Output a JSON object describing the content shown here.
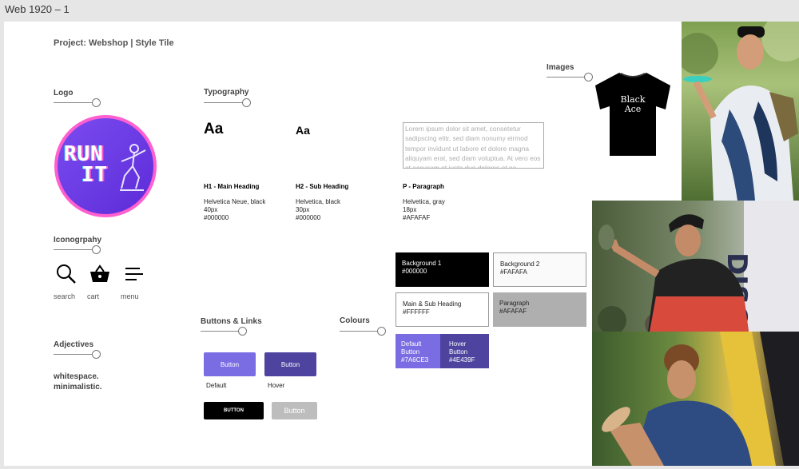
{
  "frame": {
    "title": "Web 1920 – 1"
  },
  "header": {
    "project_title": "Project: Webshop | Style Tile"
  },
  "logo": {
    "section_title": "Logo",
    "line1": "RUN",
    "line2": "IT"
  },
  "iconography": {
    "section_title": "Iconogrpahy",
    "items": [
      {
        "icon": "search-icon",
        "label": "search"
      },
      {
        "icon": "cart-icon",
        "label": "cart"
      },
      {
        "icon": "menu-icon",
        "label": "menu"
      }
    ]
  },
  "adjectives": {
    "section_title": "Adjectives",
    "line1": "whitespace.",
    "line2": "minimalistic."
  },
  "typography": {
    "section_title": "Typography",
    "samples": [
      {
        "sample": "Aa",
        "name": "H1 - Main Heading",
        "font": "Helvetica Neue, black",
        "size": "40px",
        "color": "#000000"
      },
      {
        "sample": "Aa",
        "name": "H2 - Sub Heading",
        "font": "Helvetica, black",
        "size": "30px",
        "color": "#000000"
      },
      {
        "sample": "Lorem ipsum dolor sit amet, consetetur sadipscing elitr, sed diam nonumy eirmod tempor invidunt ut labore et dolore magna aliquyam erat, sed diam voluptua. At vero eos et accusam et justo duo dolores et ea",
        "name": "P - Paragraph",
        "font": "Helvetica, gray",
        "size": "18px",
        "color": "#AFAFAF"
      }
    ]
  },
  "buttons": {
    "section_title": "Buttons & Links",
    "default_label": "Button",
    "hover_label": "Button",
    "caption_default": "Default",
    "caption_hover": "Hover",
    "black_label": "BUTTON",
    "gray_label": "Button"
  },
  "colours": {
    "section_title": "Colours",
    "swatches": [
      {
        "label": "Background 1",
        "hex": "#000000"
      },
      {
        "label": "Background 2",
        "hex": "#FAFAFA"
      },
      {
        "label": "Main & Sub Heading",
        "hex": "#FFFFFF"
      },
      {
        "label": "Paragraph",
        "hex": "#AFAFAF"
      },
      {
        "label": "Default Button",
        "hex": "#7A6CE3"
      },
      {
        "label": "Hover Button",
        "hex": "#4E439F"
      }
    ]
  },
  "images": {
    "section_title": "Images",
    "shirt_text_line1": "Black",
    "shirt_text_line2": "Ace"
  },
  "colors": {
    "default_button": "#7A6CE3",
    "hover_button": "#4E439F",
    "logo_border": "#FF5FCF"
  }
}
